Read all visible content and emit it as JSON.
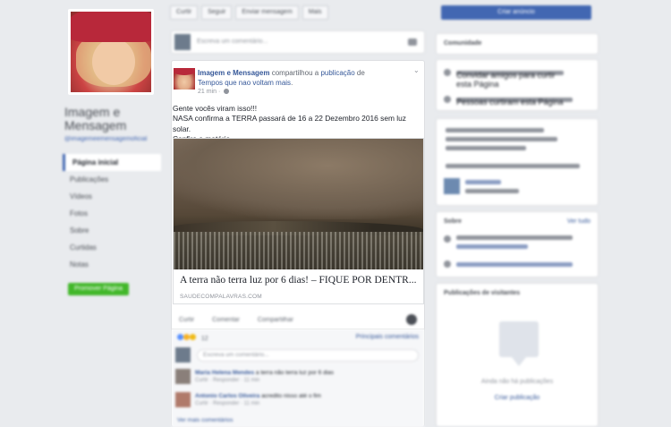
{
  "left": {
    "page_name": "Imagem e Mensagem",
    "page_handle": "@imagemeemensagemoficial",
    "nav_items": [
      "Página inicial",
      "Publicações",
      "Vídeos",
      "Fotos",
      "Sobre",
      "Curtidas",
      "Notas"
    ],
    "promote_label": "Promover Página"
  },
  "top_bar": {
    "buttons": [
      "Curtir",
      "Seguir",
      "Enviar mensagem",
      "Mais"
    ],
    "primary_label": "Criar anúncio"
  },
  "composer": {
    "placeholder": "Escreva um comentário..."
  },
  "post": {
    "author": "Imagem e Mensagem",
    "shared_text": "compartilhou a",
    "shared_link": "publicação",
    "shared_from_prefix": "de",
    "source_page": "Tempos que nao voltam mais",
    "time": "21 min",
    "text_lines": [
      "Gente vocês viram isso!!!",
      "NASA confirma a TERRA passará de 16 a 22 Dezembro 2016 sem luz solar.",
      "Confira a matéria."
    ],
    "link_title": "A terra não terra luz por 6 dias! – FIQUE POR DENTR...",
    "link_domain": "SAUDECOMPALAVRAS.COM"
  },
  "actions": {
    "like": "Curtir",
    "comment": "Comentar",
    "share": "Compartilhar"
  },
  "comments": {
    "reactions_count": "12",
    "recent_label": "Principais comentários",
    "input_placeholder": "Escreva um comentário...",
    "items": [
      {
        "name": "Maria Helena Mendes",
        "text": "a terra não terra luz por 6 dias",
        "meta": "Curtir · Responder · 11 min"
      },
      {
        "name": "Antonio Carlos Oliveira",
        "text": "acredito nisso até o fim",
        "meta": "Curtir · Responder · 11 min"
      }
    ],
    "more_label": "Ver mais comentários"
  },
  "right": {
    "community_title": "Comunidade",
    "invite_text": "Convidar amigos para curtir esta Página",
    "likes_text": "Pessoas curtiram esta Página",
    "about_title": "Sobre",
    "about_see_all": "Ver tudo",
    "media_title": "Publicações de visitantes",
    "media_empty": "Ainda não há publicações",
    "media_link": "Criar publicação"
  },
  "colors": {
    "brand_blue": "#4267b2",
    "link_blue": "#365899",
    "promote_green": "#42b72a",
    "background": "#e9ebee"
  }
}
